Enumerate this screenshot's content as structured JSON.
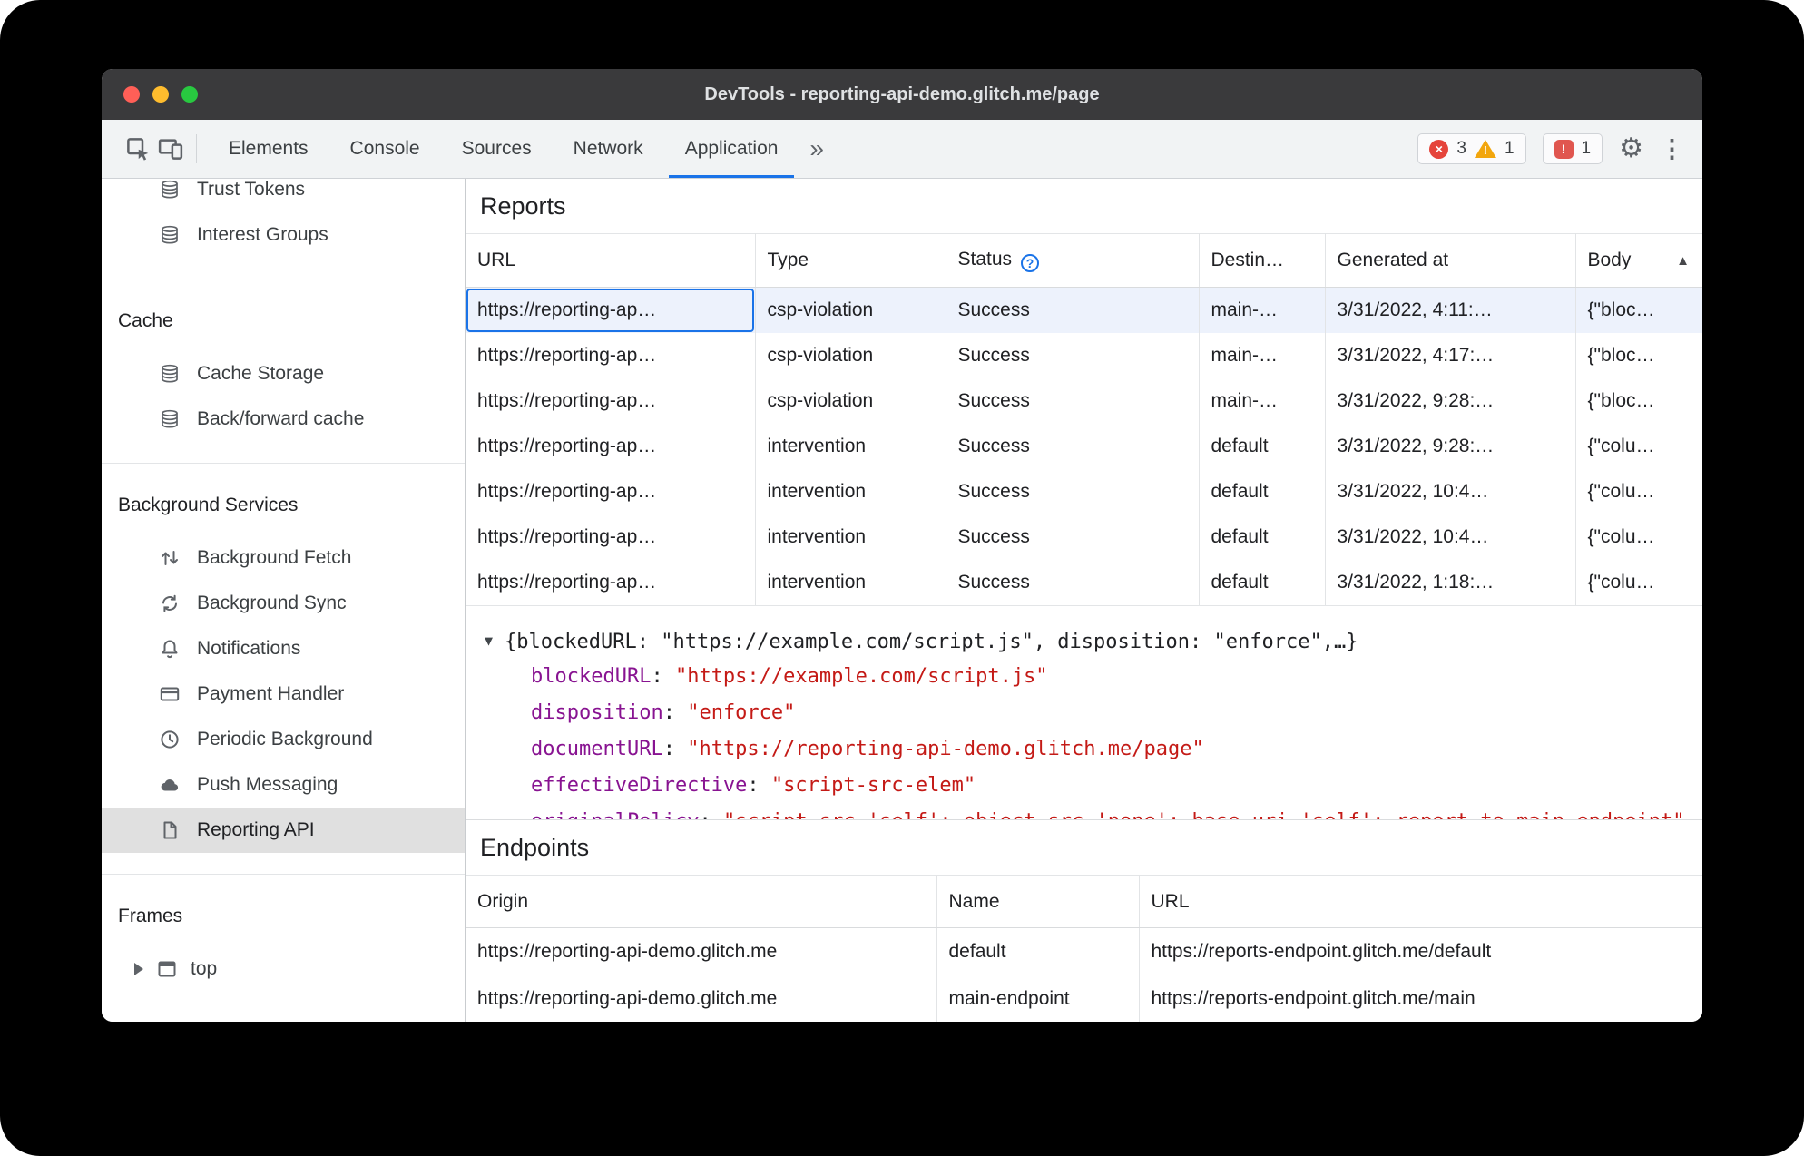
{
  "window": {
    "title": "DevTools - reporting-api-demo.glitch.me/page"
  },
  "toolbar": {
    "tabs": [
      {
        "label": "Elements"
      },
      {
        "label": "Console"
      },
      {
        "label": "Sources"
      },
      {
        "label": "Network"
      },
      {
        "label": "Application"
      }
    ],
    "more_tabs_glyph": "»",
    "error_count": "3",
    "error_glyph": "×",
    "warning_count": "1",
    "warning_glyph": "!",
    "issues_count": "1",
    "issues_glyph": "!",
    "gear_glyph": "⚙",
    "menu_glyph": "⋮"
  },
  "sidebar": {
    "trust_tokens": "Trust Tokens",
    "interest_groups": "Interest Groups",
    "cache_header": "Cache",
    "cache_storage": "Cache Storage",
    "back_forward_cache": "Back/forward cache",
    "background_header": "Background Services",
    "background_fetch": "Background Fetch",
    "background_sync": "Background Sync",
    "notifications": "Notifications",
    "payment_handler": "Payment Handler",
    "periodic_background": "Periodic Background",
    "push_messaging": "Push Messaging",
    "reporting_api": "Reporting API",
    "frames_header": "Frames",
    "top_frame": "top"
  },
  "reports": {
    "title": "Reports",
    "columns": {
      "url": "URL",
      "type": "Type",
      "status": "Status",
      "destination": "Destin…",
      "generated": "Generated at",
      "body": "Body"
    },
    "status_help_glyph": "?",
    "sort_glyph": "▲",
    "rows": [
      {
        "url": "https://reporting-ap…",
        "type": "csp-violation",
        "status": "Success",
        "destination": "main-…",
        "generated": "3/31/2022, 4:11:…",
        "body": "{\"bloc…"
      },
      {
        "url": "https://reporting-ap…",
        "type": "csp-violation",
        "status": "Success",
        "destination": "main-…",
        "generated": "3/31/2022, 4:17:…",
        "body": "{\"bloc…"
      },
      {
        "url": "https://reporting-ap…",
        "type": "csp-violation",
        "status": "Success",
        "destination": "main-…",
        "generated": "3/31/2022, 9:28:…",
        "body": "{\"bloc…"
      },
      {
        "url": "https://reporting-ap…",
        "type": "intervention",
        "status": "Success",
        "destination": "default",
        "generated": "3/31/2022, 9:28:…",
        "body": "{\"colu…"
      },
      {
        "url": "https://reporting-ap…",
        "type": "intervention",
        "status": "Success",
        "destination": "default",
        "generated": "3/31/2022, 10:4…",
        "body": "{\"colu…"
      },
      {
        "url": "https://reporting-ap…",
        "type": "intervention",
        "status": "Success",
        "destination": "default",
        "generated": "3/31/2022, 10:4…",
        "body": "{\"colu…"
      },
      {
        "url": "https://reporting-ap…",
        "type": "intervention",
        "status": "Success",
        "destination": "default",
        "generated": "3/31/2022, 1:18:…",
        "body": "{\"colu…"
      }
    ]
  },
  "preview": {
    "expander_glyph": "▼",
    "summary": "{blockedURL: \"https://example.com/script.js\", disposition: \"enforce\",…}",
    "colon": ": ",
    "properties": [
      {
        "name": "blockedURL",
        "value": "\"https://example.com/script.js\""
      },
      {
        "name": "disposition",
        "value": "\"enforce\""
      },
      {
        "name": "documentURL",
        "value": "\"https://reporting-api-demo.glitch.me/page\""
      },
      {
        "name": "effectiveDirective",
        "value": "\"script-src-elem\""
      }
    ],
    "clipped_property": {
      "name": "originalPolicy",
      "value": "\"script-src 'self'; object-src 'none'; base-uri 'self'; report-to main-endpoint\""
    }
  },
  "endpoints": {
    "title": "Endpoints",
    "columns": {
      "origin": "Origin",
      "name": "Name",
      "url": "URL"
    },
    "rows": [
      {
        "origin": "https://reporting-api-demo.glitch.me",
        "name": "default",
        "url": "https://reports-endpoint.glitch.me/default"
      },
      {
        "origin": "https://reporting-api-demo.glitch.me",
        "name": "main-endpoint",
        "url": "https://reports-endpoint.glitch.me/main"
      }
    ]
  },
  "colors": {
    "accent_blue": "#1a73e8",
    "error_red": "#e5443b",
    "warning_yellow": "#f2a60d",
    "issues_red": "#e0564f",
    "selected_row": "#edf2fc",
    "property_name": "#881391",
    "string_value": "#c41a16",
    "titlebar": "#3a3a3c"
  }
}
